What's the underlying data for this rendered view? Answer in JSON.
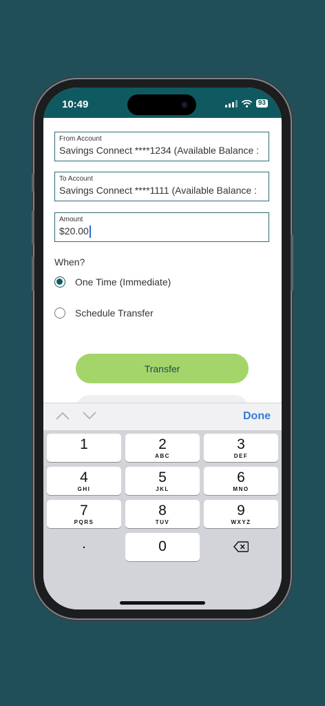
{
  "status_bar": {
    "time": "10:49",
    "battery": "93"
  },
  "form": {
    "from_account": {
      "label": "From Account",
      "value": "Savings Connect ****1234  (Available Balance  :"
    },
    "to_account": {
      "label": "To Account",
      "value": "Savings Connect ****1111   (Available Balance  :"
    },
    "amount": {
      "label": "Amount",
      "value": "$20.00"
    },
    "when_label": "When?",
    "options": [
      {
        "label": "One Time (Immediate)",
        "selected": true
      },
      {
        "label": "Schedule Transfer",
        "selected": false
      }
    ],
    "transfer_button": "Transfer"
  },
  "keyboard": {
    "done_label": "Done",
    "keys": [
      {
        "num": "1",
        "letters": ""
      },
      {
        "num": "2",
        "letters": "ABC"
      },
      {
        "num": "3",
        "letters": "DEF"
      },
      {
        "num": "4",
        "letters": "GHI"
      },
      {
        "num": "5",
        "letters": "JKL"
      },
      {
        "num": "6",
        "letters": "MNO"
      },
      {
        "num": "7",
        "letters": "PQRS"
      },
      {
        "num": "8",
        "letters": "TUV"
      },
      {
        "num": "9",
        "letters": "WXYZ"
      },
      {
        "num": ".",
        "letters": ""
      },
      {
        "num": "0",
        "letters": ""
      }
    ]
  },
  "colors": {
    "accent": "#0f5a60",
    "button": "#a4d56a",
    "link": "#2f7fd6",
    "background": "#204f5a"
  }
}
